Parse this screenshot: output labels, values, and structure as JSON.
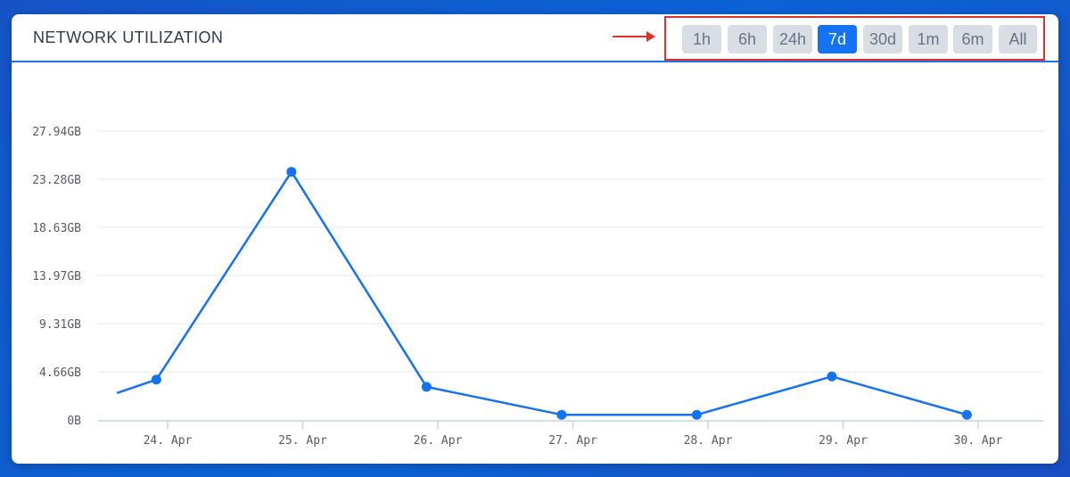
{
  "card": {
    "title": "NETWORK UTILIZATION"
  },
  "range_selector": {
    "options": [
      "1h",
      "6h",
      "24h",
      "7d",
      "30d",
      "1m",
      "6m",
      "All"
    ],
    "selected": "7d"
  },
  "colors": {
    "accent": "#1373f2",
    "highlight_border": "#e0302a",
    "arrow": "#e0302a",
    "grid": "#e6e9ee",
    "button_bg": "#d9dde4"
  },
  "chart_data": {
    "type": "line",
    "y_tick_labels": [
      "0B",
      "4.66GB",
      "9.31GB",
      "13.97GB",
      "18.63GB",
      "23.28GB",
      "27.94GB"
    ],
    "y_ticks": [
      0,
      4.66,
      9.31,
      13.97,
      18.63,
      23.28,
      27.94
    ],
    "x_tick_labels": [
      "24. Apr",
      "25. Apr",
      "26. Apr",
      "27. Apr",
      "28. Apr",
      "29. Apr",
      "30. Apr"
    ],
    "x_ticks": [
      "2024-04-24",
      "2024-04-25",
      "2024-04-26",
      "2024-04-27",
      "2024-04-28",
      "2024-04-29",
      "2024-04-30"
    ],
    "ylim": [
      0,
      27.94
    ],
    "grid": true,
    "series": [
      {
        "x": [
          "2024-04-23T15:00",
          "2024-04-23T22:00",
          "2024-04-24T22:00",
          "2024-04-25T22:00",
          "2024-04-26T22:00",
          "2024-04-27T22:00",
          "2024-04-28T22:00",
          "2024-04-29T22:00"
        ],
        "y": [
          2.6,
          3.9,
          24.0,
          3.2,
          0.5,
          0.5,
          4.2,
          0.5
        ],
        "markers": [
          false,
          true,
          true,
          true,
          true,
          true,
          true,
          true
        ]
      }
    ]
  }
}
